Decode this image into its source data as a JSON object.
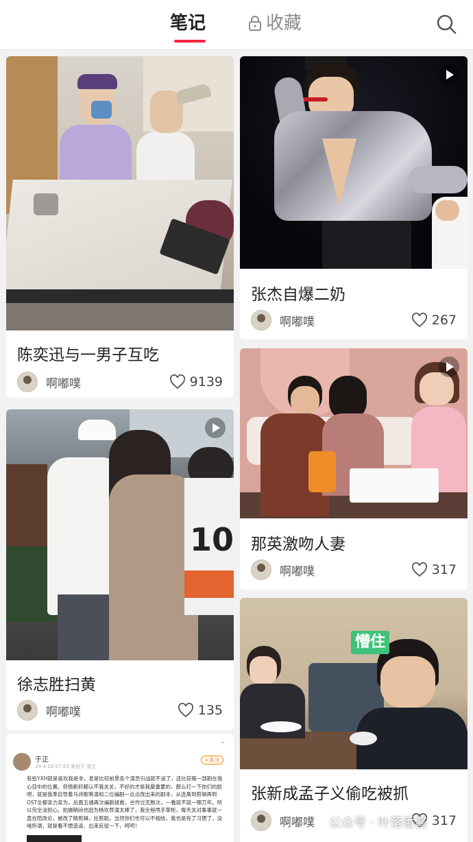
{
  "header": {
    "tabs": [
      {
        "label": "笔记",
        "active": true
      },
      {
        "label": "收藏",
        "active": false
      }
    ]
  },
  "feed": {
    "left": [
      {
        "title": "陈奕迅与一男子互吃",
        "author": "啊嘟噗",
        "likes": "9139",
        "video": false
      },
      {
        "title": "徐志胜扫黄",
        "author": "啊嘟噗",
        "likes": "135",
        "video": true
      },
      {
        "title": "",
        "author": "",
        "likes": "",
        "video": false,
        "screenshot_text": {
          "name": "于正",
          "follow": "+关注",
          "date": "24-4-16 07:53 来自于 浙江",
          "body": "有些YXH就是喜欢我是非，老是比较前景各个演员引战就不说了，还比较每一部剧在我心目中的位置。但情新好都认不我关关，不好的才是我最重要的，那么打一下你们的脸吧，就是我拿自导着马诗歌等演和二位编剧一点点改出来的剧本，从选角到剪辑再到OST全都亲力亲为，后面五福再次编剧拯救，合作过无数次，一看就不就一眼万年。所以完全没担心。拍摄期间也因为杨欢导演太棒了，我全程甩手掌柜，每天关对事事就一直在陪改论，被改了精剪辑，拉剪助，当然你们也可以不相信，我也是有了习惯了，没啥所谓，就是看不惯造谣，出来反驳一下，呵呵！"
        }
      }
    ],
    "right": [
      {
        "title": "张杰自爆二奶",
        "author": "啊嘟噗",
        "likes": "267",
        "video": true
      },
      {
        "title": "那英激吻人妻",
        "author": "啊嘟噗",
        "likes": "317",
        "video": true
      },
      {
        "title": "张新成孟子义偷吃被抓",
        "author": "啊嘟噗",
        "likes": "317",
        "video": false,
        "sticker": "懵住"
      }
    ]
  },
  "watermark": "公众号 · 叶落香酱",
  "colors": {
    "accent": "#ff2442",
    "background": "#f2f2f2"
  }
}
